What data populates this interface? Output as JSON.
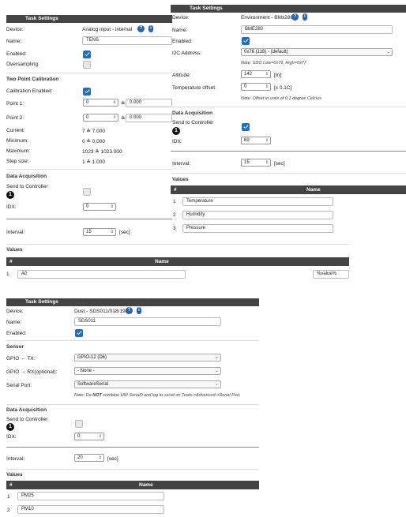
{
  "panel_a": {
    "header": "Task Settings",
    "device_label": "Device:",
    "device_value": "Analog input - internal",
    "name_label": "Name:",
    "name_value": "TENS",
    "enabled_label": "Enabled:",
    "oversampling_label": "Oversampling:",
    "tpc_title": "Two Point Calibration",
    "cal_enabled_label": "Calibration Enabled:",
    "point1_label": "Point 1:",
    "point1_raw": "0",
    "point1_val": "0.000",
    "point2_label": "Point 2:",
    "point2_raw": "0",
    "point2_val": "0.000",
    "approx": "≙",
    "current_label": "Current:",
    "current_value": "7 ≙ 7.000",
    "minimum_label": "Minimum:",
    "minimum_value": "0 ≙ 0.000",
    "maximum_label": "Maximum:",
    "maximum_value": "1023 ≙ 1023.000",
    "stepsize_label": "Step size:",
    "stepsize_value": "1 ≙ 1.000",
    "da_title": "Data Acquisition",
    "send_label": "Send to Controller",
    "badge": "1",
    "idx_label": "IDX:",
    "idx_value": "0",
    "interval_label": "Interval:",
    "interval_value": "15",
    "interval_unit": "[sec]",
    "values_title": "Values",
    "col_hash": "#",
    "col_name": "Name",
    "rows": [
      {
        "num": "1",
        "name": "A0",
        "formula": "%value%"
      }
    ]
  },
  "panel_b": {
    "header": "Task Settings",
    "device_label": "Device:",
    "device_value": "Environment - BMx280",
    "name_label": "Name:",
    "name_value": "BME280",
    "enabled_label": "Enabled:",
    "i2c_label": "I2C Address:",
    "i2c_value": "0x76 (118) - (default)",
    "i2c_note": "Note: SDO Low=0x76, High=0x77",
    "altitude_label": "Altitude:",
    "altitude_value": "142",
    "altitude_unit": "[m]",
    "tempoff_label": "Temperature offset:",
    "tempoff_value": "0",
    "tempoff_unit": "[x 0.1C]",
    "tempoff_note": "Note: Offset in units of 0.1 degree Celcius",
    "da_title": "Data Acquisition",
    "send_label": "Send to Controller",
    "badge": "1",
    "idx_label": "IDX:",
    "idx_value": "69",
    "interval_label": "Interval:",
    "interval_value": "15",
    "interval_unit": "[sec]",
    "values_title": "Values",
    "col_hash": "#",
    "col_name": "Name",
    "rows": [
      {
        "num": "1",
        "name": "Temperature"
      },
      {
        "num": "2",
        "name": "Humidity"
      },
      {
        "num": "3",
        "name": "Pressure"
      }
    ]
  },
  "panel_c": {
    "header": "Task Settings",
    "device_label": "Device:",
    "device_value": "Dust - SDS011/018/198",
    "name_label": "Name:",
    "name_value": "SDS011",
    "enabled_label": "Enabled:",
    "sensor_title": "Sensor",
    "gpio_tx_label": "GPIO ← TX:",
    "gpio_tx_value": "GPIO-12 (D6)",
    "gpio_rx_label": "GPIO → RX(optional):",
    "gpio_rx_value": "- None -",
    "serial_label": "Serial Port:",
    "serial_value": "SoftwareSerial",
    "note_pre": "Note: Do ",
    "note_bold": "NOT",
    "note_post": " combine HW Serial0 and log to serial on Tools->Advanced->Serial Port.",
    "da_title": "Data Acquisition",
    "send_label": "Send to Controller",
    "badge": "1",
    "idx_label": "IDX:",
    "idx_value": "0",
    "interval_label": "Interval:",
    "interval_value": "20",
    "interval_unit": "[sec]",
    "values_title": "Values",
    "col_hash": "#",
    "col_name": "Name",
    "rows": [
      {
        "num": "1",
        "name": "PM25"
      },
      {
        "num": "2",
        "name": "PM10"
      }
    ]
  },
  "icons": {
    "question": "?",
    "info": "i",
    "chevron": "⌄",
    "spin": "⇕"
  },
  "colors": {
    "header_bg": "#444444",
    "checkbox_on": "#1e6fc3",
    "help_icon": "#2461b5"
  }
}
